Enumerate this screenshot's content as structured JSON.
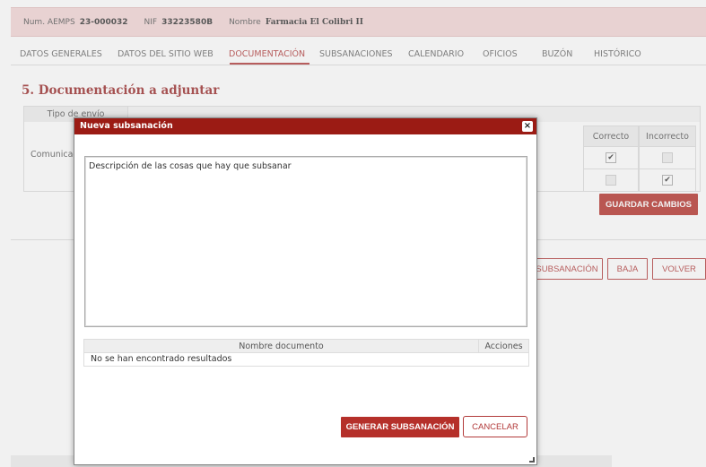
{
  "header": {
    "num_label": "Num. AEMPS",
    "num_value": "23-000032",
    "nif_label": "NIF",
    "nif_value": "33223580B",
    "nombre_label": "Nombre",
    "nombre_value": "Farmacia El Colibri II"
  },
  "tabs": [
    {
      "label": "DATOS GENERALES"
    },
    {
      "label": "DATOS DEL SITIO WEB"
    },
    {
      "label": "DOCUMENTACIÓN"
    },
    {
      "label": "SUBSANACIONES"
    },
    {
      "label": "CALENDARIO"
    },
    {
      "label": "OFICIOS"
    },
    {
      "label": "BUZÓN"
    },
    {
      "label": "HISTÓRICO"
    }
  ],
  "active_tab": "DOCUMENTACIÓN",
  "section_title": "5. Documentación a adjuntar",
  "bg_table": {
    "tipo_envio_header": "Tipo de envío",
    "comunicacion": "Comunicació",
    "correcto_header": "Correcto",
    "incorrecto_header": "Incorrecto",
    "rows": [
      {
        "correcto": true,
        "correcto_enabled": true,
        "incorrecto": false,
        "incorrecto_enabled": false
      },
      {
        "correcto": false,
        "correcto_enabled": false,
        "incorrecto": true,
        "incorrecto_enabled": true
      }
    ]
  },
  "buttons": {
    "guardar_cambios": "GUARDAR CAMBIOS",
    "subsanacion": "SUBSANACIÓN",
    "baja": "BAJA",
    "volver": "VOLVER"
  },
  "modal": {
    "title": "Nueva subsanación",
    "close_glyph": "×",
    "description_text": "Descripción de las cosas que hay que subsanar",
    "doc_table": {
      "col_nombre": "Nombre documento",
      "col_acciones": "Acciones",
      "empty_text": "No se han encontrado resultados"
    },
    "generar_label": "GENERAR SUBSANACIÓN",
    "cancelar_label": "CANCELAR"
  },
  "colors": {
    "accent": "#b5302a",
    "header_bg": "#f3d6d6",
    "modal_header": "#9b1b14"
  }
}
